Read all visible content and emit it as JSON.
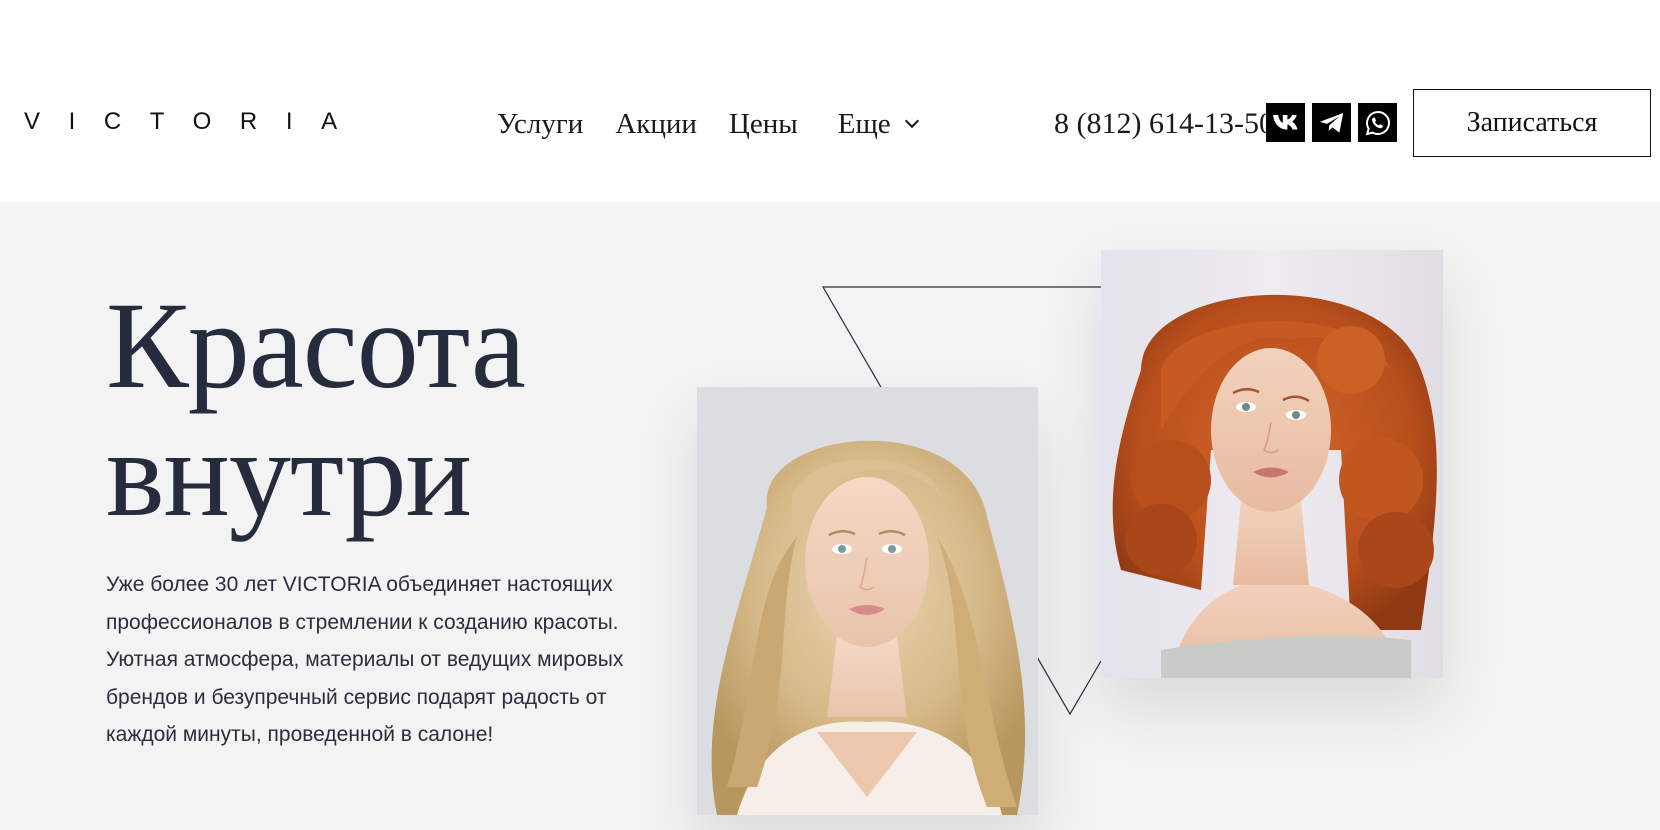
{
  "header": {
    "logo": "VICTORIA",
    "nav": [
      {
        "label": "Услуги"
      },
      {
        "label": "Акции"
      },
      {
        "label": "Цены"
      }
    ],
    "more_label": "Еще",
    "phone": "8 (812) 614-13-50",
    "social": [
      {
        "icon": "vk-icon"
      },
      {
        "icon": "telegram-icon"
      },
      {
        "icon": "whatsapp-icon"
      }
    ],
    "cta_label": "Записаться"
  },
  "hero": {
    "title_line1": "Красота",
    "title_line2": "внутри",
    "paragraph1": "Уже более 30 лет VICTORIA объединяет настоящих профессионалов в стремлении к созданию красоты.",
    "paragraph2": "Уютная атмосфера, материалы от ведущих мировых брендов и безупречный сервис подарят радость от каждой минуты, проведенной в салоне!",
    "images": [
      {
        "name": "blonde-woman-portrait"
      },
      {
        "name": "redhead-woman-portrait"
      }
    ],
    "colors": {
      "title": "#262b3d",
      "background": "#f3f3f4",
      "social_bg": "#000000"
    }
  }
}
